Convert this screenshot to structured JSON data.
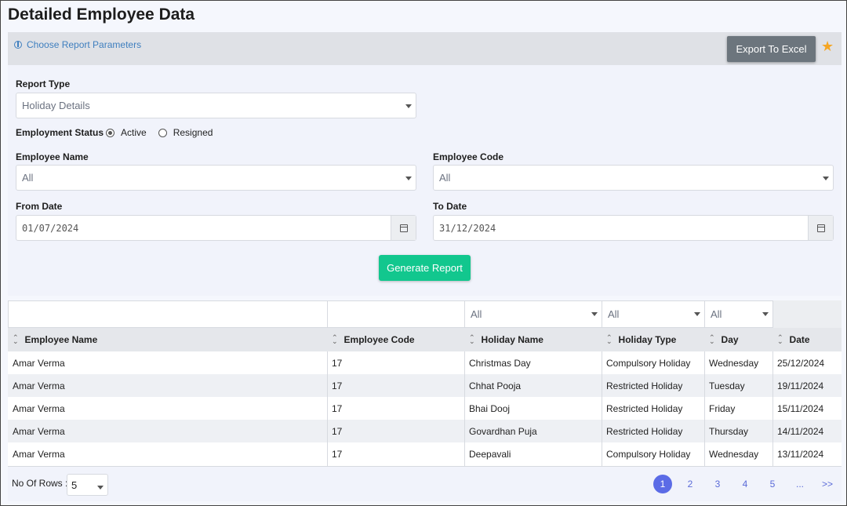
{
  "page_title": "Detailed Employee Data",
  "param_bar": {
    "link_label": "Choose Report Parameters",
    "export_label": "Export To Excel"
  },
  "form": {
    "report_type_label": "Report Type",
    "report_type_value": "Holiday Details",
    "employment_status_label": "Employment Status",
    "status_options": [
      "Active",
      "Resigned"
    ],
    "status_selected": "Active",
    "employee_name_label": "Employee Name",
    "employee_name_value": "All",
    "employee_code_label": "Employee Code",
    "employee_code_value": "All",
    "from_date_label": "From Date",
    "from_date_value": "01/07/2024",
    "to_date_label": "To Date",
    "to_date_value": "31/12/2024",
    "generate_label": "Generate Report"
  },
  "grid": {
    "filters": {
      "holiday_name": "All",
      "holiday_type": "All",
      "day": "All"
    },
    "columns": [
      "Employee Name",
      "Employee Code",
      "Holiday Name",
      "Holiday Type",
      "Day",
      "Date"
    ],
    "rows": [
      [
        "Amar Verma",
        "17",
        "Christmas Day",
        "Compulsory Holiday",
        "Wednesday",
        "25/12/2024"
      ],
      [
        "Amar Verma",
        "17",
        "Chhat Pooja",
        "Restricted Holiday",
        "Tuesday",
        "19/11/2024"
      ],
      [
        "Amar Verma",
        "17",
        "Bhai Dooj",
        "Restricted Holiday",
        "Friday",
        "15/11/2024"
      ],
      [
        "Amar Verma",
        "17",
        "Govardhan Puja",
        "Restricted Holiday",
        "Thursday",
        "14/11/2024"
      ],
      [
        "Amar Verma",
        "17",
        "Deepavali",
        "Compulsory Holiday",
        "Wednesday",
        "13/11/2024"
      ]
    ]
  },
  "footer": {
    "rows_label": "No Of Rows :",
    "rows_value": "5",
    "pages": [
      "1",
      "2",
      "3",
      "4",
      "5",
      "...",
      ">>"
    ],
    "current_page": "1"
  },
  "colors": {
    "accent": "#12c78e",
    "export": "#6c757d",
    "pager_active": "#5b6be6",
    "star": "#f5a623"
  }
}
